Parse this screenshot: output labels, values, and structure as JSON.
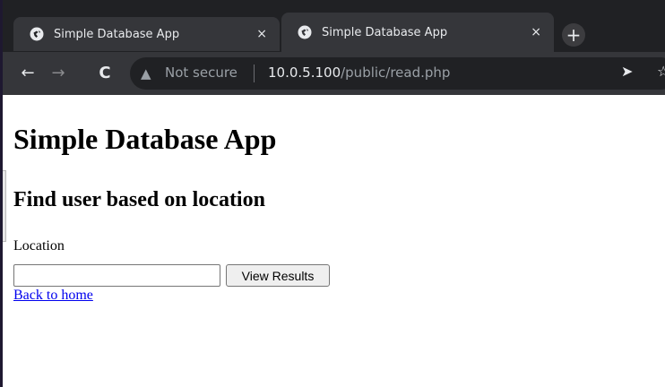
{
  "browser": {
    "tabs": [
      {
        "title": "Simple Database App",
        "close": "×",
        "favicon": "chrome-globe-icon"
      },
      {
        "title": "Simple Database App",
        "close": "×",
        "favicon": "chrome-globe-icon"
      }
    ],
    "new_tab": "+",
    "nav": {
      "back": "←",
      "forward": "→",
      "reload": "C"
    },
    "omnibox": {
      "warning": "▲",
      "security_text": "Not secure",
      "host": "10.0.5.100",
      "path": "/public/read.php"
    },
    "share": "➤",
    "star": "☆"
  },
  "page": {
    "h1": "Simple Database App",
    "h2": "Find user based on location",
    "location_label": "Location",
    "location_value": "",
    "submit_label": "View Results",
    "back_link": "Back to home"
  }
}
